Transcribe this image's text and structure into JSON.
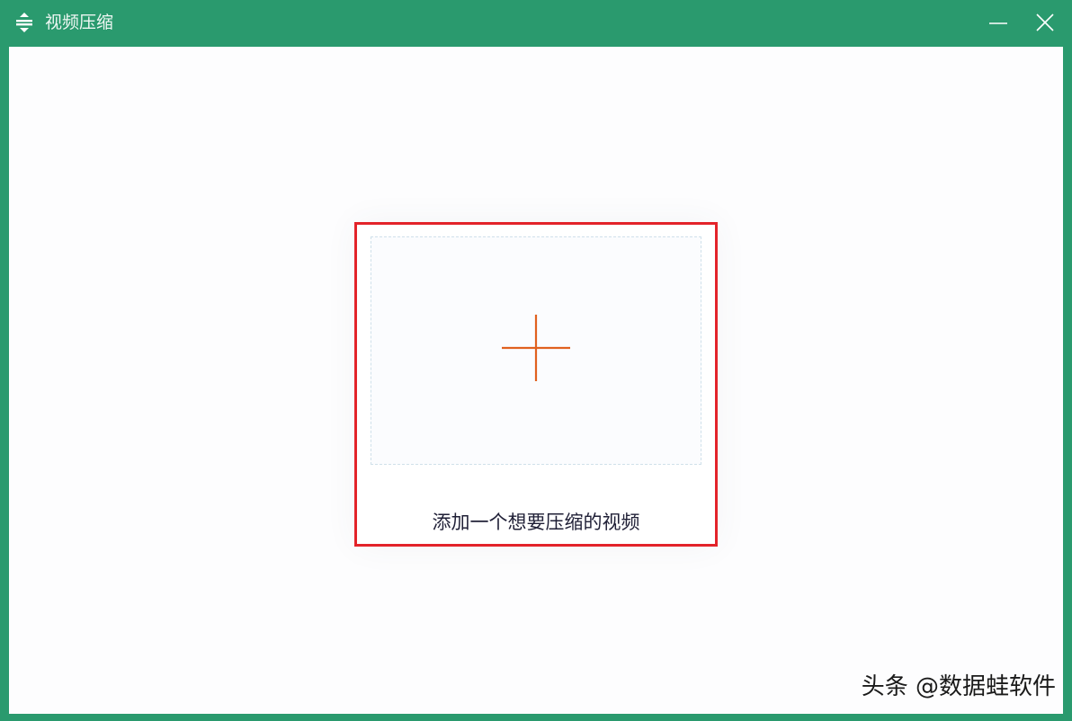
{
  "window": {
    "title": "视频压缩",
    "app_icon": "compress-icon",
    "minimize_icon": "minimize-icon",
    "close_icon": "close-icon"
  },
  "main": {
    "add_video_label": "添加一个想要压缩的视频",
    "add_icon": "plus-icon"
  },
  "watermark": {
    "text": "头条 @数据蛙软件"
  },
  "colors": {
    "titlebar": "#2a9a6e",
    "highlight_border": "#e3232a",
    "plus": "#e0611f"
  }
}
